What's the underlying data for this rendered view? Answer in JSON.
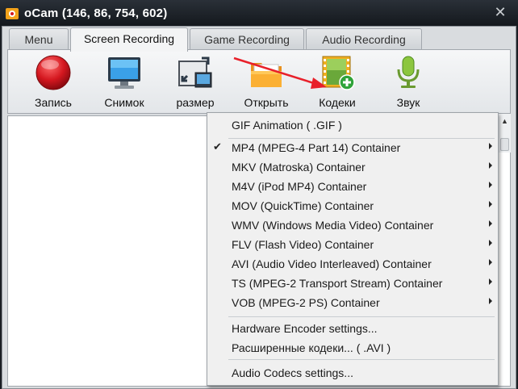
{
  "window": {
    "title": "oCam (146, 86, 754, 602)",
    "close_glyph": "✕",
    "icon": "ocam-app-icon"
  },
  "tabs": [
    {
      "label": "Menu",
      "active": false
    },
    {
      "label": "Screen Recording",
      "active": true
    },
    {
      "label": "Game Recording",
      "active": false
    },
    {
      "label": "Audio Recording",
      "active": false
    }
  ],
  "toolbar": {
    "record_label": "Запись",
    "snapshot_label": "Снимок",
    "size_label": "размер",
    "open_label": "Открыть",
    "codecs_label": "Кодеки",
    "sound_label": "Звук"
  },
  "codec_menu": {
    "gif": "GIF Animation ( .GIF )",
    "containers": [
      {
        "label": "MP4 (MPEG-4 Part 14) Container",
        "checked": true
      },
      {
        "label": "MKV (Matroska) Container",
        "checked": false
      },
      {
        "label": "M4V (iPod MP4) Container",
        "checked": false
      },
      {
        "label": "MOV (QuickTime) Container",
        "checked": false
      },
      {
        "label": "WMV (Windows Media Video) Container",
        "checked": false
      },
      {
        "label": "FLV (Flash Video) Container",
        "checked": false
      },
      {
        "label": "AVI (Audio Video Interleaved) Container",
        "checked": false
      },
      {
        "label": "TS (MPEG-2 Transport Stream) Container",
        "checked": false
      },
      {
        "label": "VOB (MPEG-2 PS) Container",
        "checked": false
      }
    ],
    "check_glyph": "✔",
    "hardware_encoder": "Hardware Encoder settings...",
    "advanced_codecs": "Расширенные кодеки... ( .AVI )",
    "audio_codecs": "Audio Codecs settings..."
  },
  "colors": {
    "annotation_arrow": "#e8202a",
    "record_red": "#d4171f",
    "titlebar": "#1b1f24"
  }
}
